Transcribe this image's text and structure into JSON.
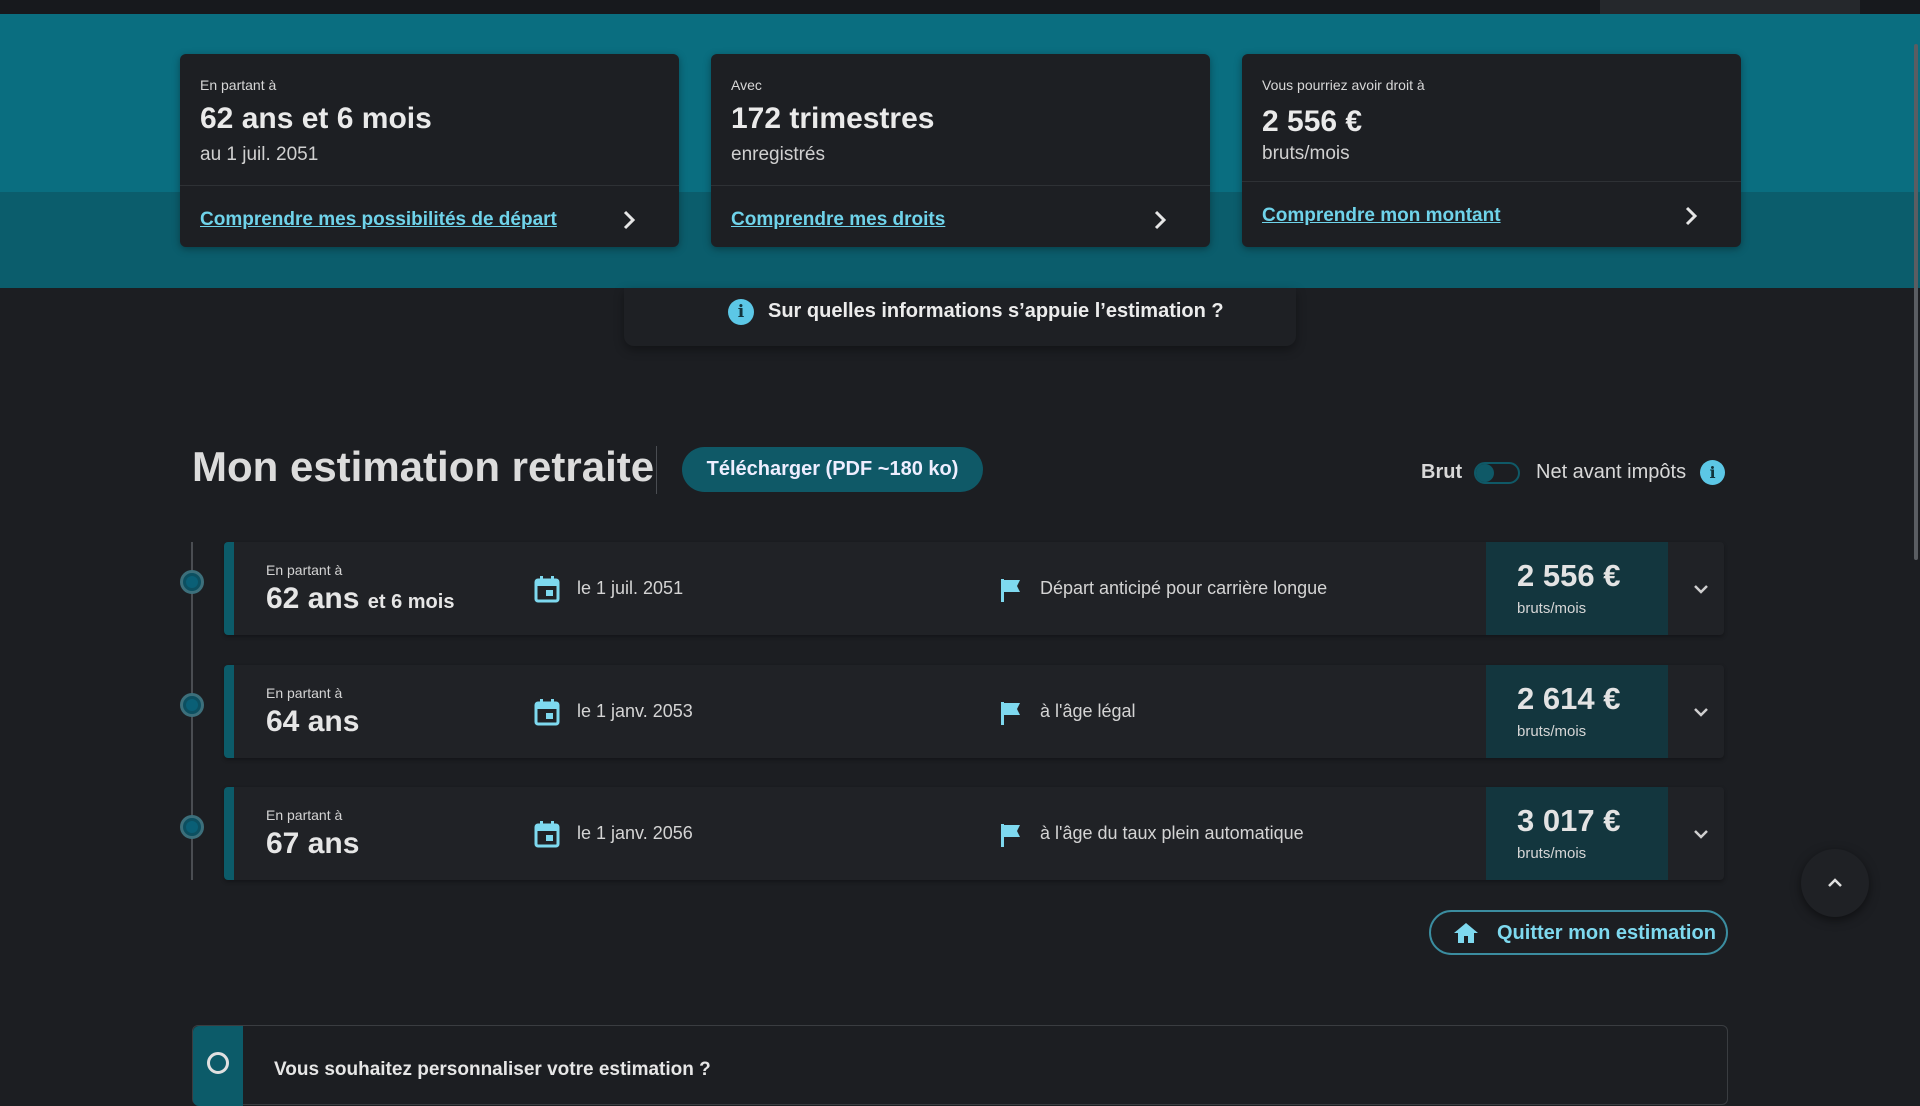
{
  "cards": [
    {
      "label": "En partant à",
      "big": "62 ans et 6 mois",
      "sub": "au 1 juil. 2051",
      "link": "Comprendre mes possibilités de départ"
    },
    {
      "label": "Avec",
      "big": "172 trimestres",
      "sub": "enregistrés",
      "link": "Comprendre mes droits"
    },
    {
      "label": "Vous pourriez avoir droit à",
      "big": "2 556 €",
      "sub": "bruts/mois",
      "link": "Comprendre mon montant"
    }
  ],
  "info_bar": {
    "text": "Sur quelles informations s’appuie l’estimation ?",
    "icon": "info-icon"
  },
  "section": {
    "title": "Mon estimation retraite",
    "download_label": "Télécharger (PDF ~180 ko)",
    "toggle_left": "Brut",
    "toggle_right": "Net avant impôts"
  },
  "rows": [
    {
      "label": "En partant à",
      "age": "62 ans",
      "age_extra": "et 6 mois",
      "date": "le 1 juil. 2051",
      "reason": "Départ anticipé pour carrière longue",
      "amount": "2 556 €",
      "unit": "bruts/mois"
    },
    {
      "label": "En partant à",
      "age": "64 ans",
      "age_extra": "",
      "date": "le 1 janv. 2053",
      "reason": "à l'âge légal",
      "amount": "2 614 €",
      "unit": "bruts/mois"
    },
    {
      "label": "En partant à",
      "age": "67 ans",
      "age_extra": "",
      "date": "le 1 janv. 2056",
      "reason": "à l'âge du taux plein automatique",
      "amount": "3 017 €",
      "unit": "bruts/mois"
    }
  ],
  "quit_label": "Quitter mon estimation",
  "personalize": "Vous souhaitez personnaliser votre estimation ?",
  "colors": {
    "accent": "#6fd3ea",
    "hero": "#0a6e80",
    "button": "#0f5967",
    "background": "#1c1e22"
  }
}
